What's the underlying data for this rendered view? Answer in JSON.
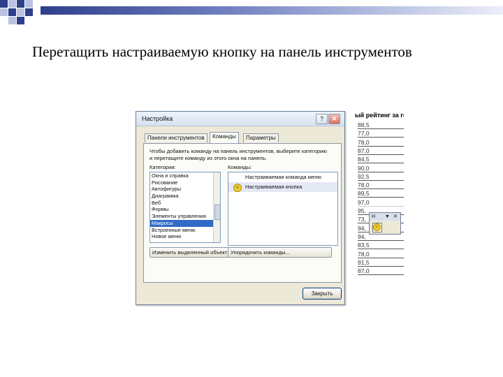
{
  "slide": {
    "title": "Перетащить настраиваемую кнопку на панель инструментов"
  },
  "colors": {
    "band_dark": "#2e3f8c",
    "square_dark": "#2e3f8c",
    "square_light": "#b9c2e3",
    "selection": "#316ac5"
  },
  "spreadsheet": {
    "header": "ый рейтинг за год",
    "values": [
      "88,5",
      "77,0",
      "78,0",
      "87,0",
      "84,5",
      "90,0",
      "92,5",
      "78,0",
      "89,5",
      "97,0",
      "95,",
      "73,",
      "94,",
      "94,",
      "83,5",
      "78,0",
      "91,5",
      "87,0"
    ]
  },
  "dialog": {
    "title": "Настройка",
    "help_icon": "question-icon",
    "close_icon": "close-icon",
    "tabs": [
      {
        "label": "Панели инструментов"
      },
      {
        "label": "Команды"
      },
      {
        "label": "Параметры"
      }
    ],
    "active_tab": "Команды",
    "hint": "Чтобы добавить команду на панель инструментов, выберите категорию и перетащите команду из этого окна на панель.",
    "categories_label": "Категории:",
    "commands_label": "Команды:",
    "categories": [
      {
        "label": "Окна и справка"
      },
      {
        "label": "Рисование"
      },
      {
        "label": "Автофигуры"
      },
      {
        "label": "Диаграмма"
      },
      {
        "label": "Веб"
      },
      {
        "label": "Формы"
      },
      {
        "label": "Элементы управления"
      },
      {
        "label": "Макросы"
      },
      {
        "label": "Встроенные меню"
      },
      {
        "label": "Новое меню"
      }
    ],
    "selected_category": "Макросы",
    "commands": [
      {
        "label": "Настраиваемая команда меню",
        "icon": "none"
      },
      {
        "label": "Настраиваемая кнопка",
        "icon": "smiley-icon"
      }
    ],
    "modify_button": "Изменить выделенный объект",
    "rearrange_button": "Упорядочить команды...",
    "close_button": "Закрыть"
  },
  "mini_toolbar": {
    "title": "Н",
    "dropdown_icon": "chevron-down-icon",
    "close_icon": "close-icon",
    "button_icon": "smiley-icon"
  }
}
